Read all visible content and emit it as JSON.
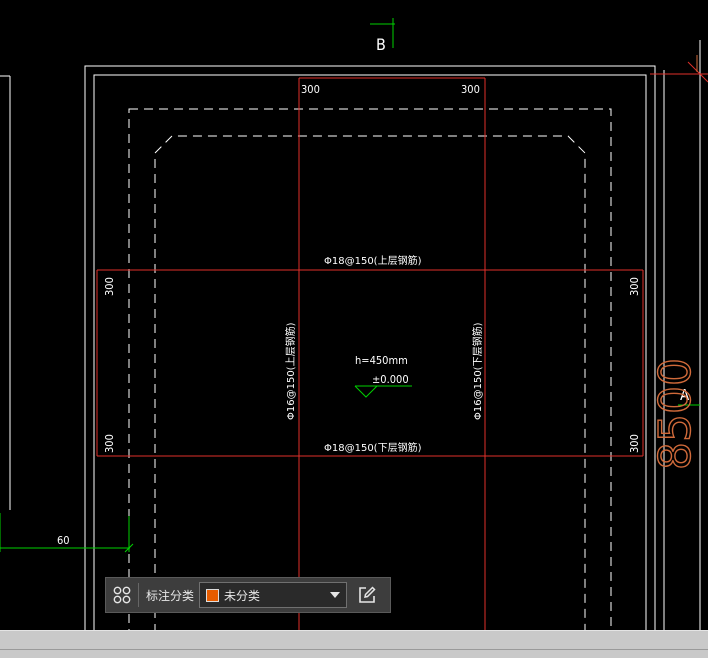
{
  "drawing": {
    "section_label": "B",
    "axis_label_a": "A",
    "dimension_vertical": "8500",
    "dimension_left": "60",
    "top_dims": [
      "300",
      "300"
    ],
    "side_dims": [
      "300",
      "300",
      "300",
      "300"
    ],
    "rebar_top_layer": "Φ18@150(上层钢筋)",
    "rebar_bottom_layer": "Φ18@150(下层钢筋)",
    "rebar_vertical_top": "Φ16@150(上层钢筋)",
    "rebar_vertical_bottom": "Φ16@150(下层钢筋)",
    "thickness": "h=450mm",
    "elevation": "±0.000",
    "colors": {
      "background": "#000000",
      "outline": "#ffffff",
      "rebar": "#e0302a",
      "dimension": "#00d000",
      "axis_dim": "#d06a3a"
    }
  },
  "toolbar": {
    "grid_icon": "grid-icon",
    "label": "标注分类",
    "category_value": "未分类",
    "category_color": "#e65c00",
    "edit_icon": "edit-icon"
  }
}
